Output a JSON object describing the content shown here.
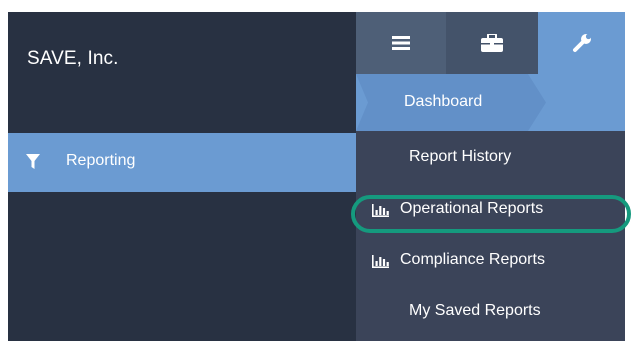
{
  "brand": {
    "name": "SAVE, Inc."
  },
  "sidebar": {
    "items": [
      {
        "label": "Reporting",
        "icon": "filter-icon"
      }
    ]
  },
  "toolbar": {
    "buttons": [
      {
        "icon": "hamburger-menu-icon"
      },
      {
        "icon": "briefcase-icon"
      },
      {
        "icon": "wrench-icon"
      }
    ]
  },
  "breadcrumb": {
    "current": "Dashboard"
  },
  "menu": {
    "items": [
      {
        "label": "Report History",
        "icon": null
      },
      {
        "label": "Operational Reports",
        "icon": "bar-chart-icon"
      },
      {
        "label": "Compliance Reports",
        "icon": "bar-chart-icon"
      },
      {
        "label": "My Saved Reports",
        "icon": null
      }
    ]
  },
  "colors": {
    "dark_panel": "#283142",
    "accent_blue": "#6b9bd2",
    "menu_bg": "#3b4459",
    "highlight_ring": "#159a7e"
  }
}
